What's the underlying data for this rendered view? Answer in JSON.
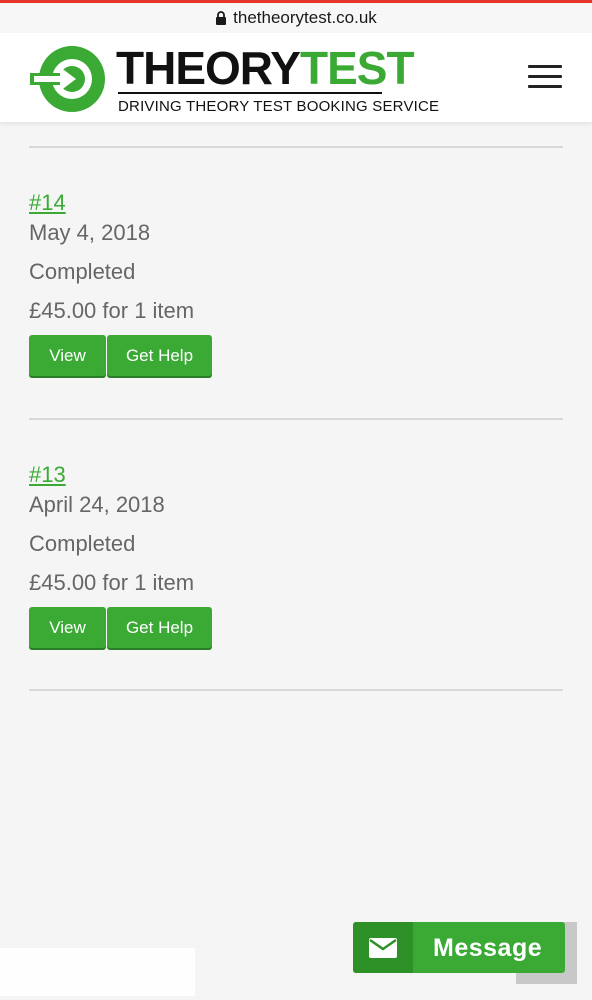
{
  "browser": {
    "url": "thetheorytest.co.uk",
    "lock_icon": "lock-icon",
    "accent_color": "#e8352c"
  },
  "header": {
    "logo": {
      "title_part1": "THEORY",
      "title_part2": "TEST",
      "subtitle": "DRIVING THEORY TEST BOOKING SERVICE",
      "icon": "arrow-circle-icon"
    },
    "menu_icon": "hamburger-menu-icon"
  },
  "colors": {
    "brand_green": "#3aaa35",
    "text_grey": "#666666",
    "background": "#f5f5f5"
  },
  "orders": [
    {
      "number": "#14",
      "date": "May 4, 2018",
      "status": "Completed",
      "total": "£45.00 for 1 item",
      "view_label": "View",
      "help_label": "Get Help"
    },
    {
      "number": "#13",
      "date": "April 24, 2018",
      "status": "Completed",
      "total": "£45.00 for 1 item",
      "view_label": "View",
      "help_label": "Get Help"
    }
  ],
  "message_widget": {
    "label": "Message",
    "icon": "envelope-icon"
  }
}
